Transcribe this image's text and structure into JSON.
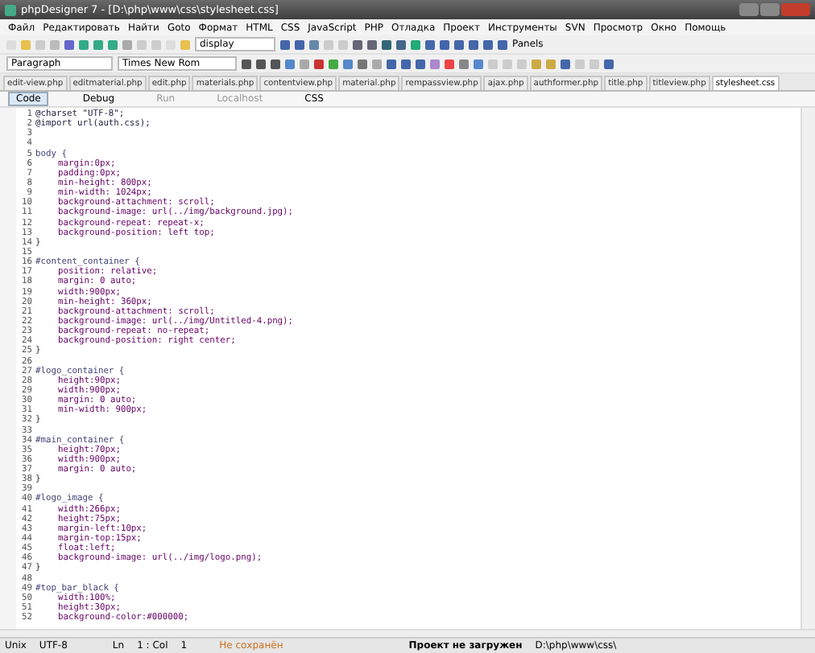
{
  "window": {
    "title": "phpDesigner 7 - [D:\\php\\www\\css\\stylesheet.css]"
  },
  "menu": [
    "Файл",
    "Редактировать",
    "Найти",
    "Goto",
    "Формат",
    "HTML",
    "CSS",
    "JavaScript",
    "PHP",
    "Отладка",
    "Проект",
    "Инструменты",
    "SVN",
    "Просмотр",
    "Окно",
    "Помощь"
  ],
  "toolbar": {
    "search_value": "display",
    "panels": "Panels"
  },
  "format_bar": {
    "paragraph": "Paragraph",
    "font": "Times New Rom"
  },
  "tabs": [
    {
      "label": "edit-view.php",
      "selected": false
    },
    {
      "label": "editmaterial.php",
      "selected": false
    },
    {
      "label": "edit.php",
      "selected": false
    },
    {
      "label": "materials.php",
      "selected": false
    },
    {
      "label": "contentview.php",
      "selected": false
    },
    {
      "label": "material.php",
      "selected": false
    },
    {
      "label": "rempassview.php",
      "selected": false
    },
    {
      "label": "ajax.php",
      "selected": false
    },
    {
      "label": "authformer.php",
      "selected": false
    },
    {
      "label": "title.php",
      "selected": false
    },
    {
      "label": "titleview.php",
      "selected": false
    },
    {
      "label": "stylesheet.css",
      "selected": true
    }
  ],
  "sub_toolbar": [
    {
      "label": "Code",
      "selected": true,
      "disabled": false
    },
    {
      "label": "Debug",
      "selected": false,
      "disabled": false
    },
    {
      "label": "Run",
      "selected": false,
      "disabled": true
    },
    {
      "label": "Localhost",
      "selected": false,
      "disabled": true
    },
    {
      "label": "CSS",
      "selected": false,
      "disabled": false
    }
  ],
  "code": [
    {
      "n": "1",
      "kind": "at",
      "text": "@charset \"UTF-8\";"
    },
    {
      "n": "2",
      "kind": "at",
      "text": "@import url(auth.css);"
    },
    {
      "n": "3",
      "kind": "blank"
    },
    {
      "n": "4",
      "kind": "blank"
    },
    {
      "n": "5",
      "kind": "selector",
      "text": "body {"
    },
    {
      "n": "6",
      "kind": "property",
      "text": "margin:0px;"
    },
    {
      "n": "7",
      "kind": "property",
      "text": "padding:0px;"
    },
    {
      "n": "8",
      "kind": "property",
      "text": "min-height: 800px;"
    },
    {
      "n": "9",
      "kind": "property",
      "text": "min-width: 1024px;"
    },
    {
      "n": "10",
      "kind": "property",
      "text": "background-attachment: scroll;"
    },
    {
      "n": "11",
      "kind": "property",
      "text": "background-image: url(../img/background.jpg);"
    },
    {
      "n": "12",
      "kind": "property",
      "text": "background-repeat: repeat-x;"
    },
    {
      "n": "13",
      "kind": "property",
      "text": "background-position: left top;"
    },
    {
      "n": "14",
      "kind": "brace",
      "text": "}"
    },
    {
      "n": "15",
      "kind": "blank"
    },
    {
      "n": "16",
      "kind": "selector",
      "text": "#content_container {"
    },
    {
      "n": "17",
      "kind": "property",
      "text": "position: relative;"
    },
    {
      "n": "18",
      "kind": "property",
      "text": "margin: 0 auto;"
    },
    {
      "n": "19",
      "kind": "property",
      "text": "width:900px;"
    },
    {
      "n": "20",
      "kind": "property",
      "text": "min-height: 360px;"
    },
    {
      "n": "21",
      "kind": "property",
      "text": "background-attachment: scroll;"
    },
    {
      "n": "22",
      "kind": "property",
      "text": "background-image: url(../img/Untitled-4.png);"
    },
    {
      "n": "23",
      "kind": "property",
      "text": "background-repeat: no-repeat;"
    },
    {
      "n": "24",
      "kind": "property",
      "text": "background-position: right center;"
    },
    {
      "n": "25",
      "kind": "brace",
      "text": "}"
    },
    {
      "n": "26",
      "kind": "blank"
    },
    {
      "n": "27",
      "kind": "selector",
      "text": "#logo_container {"
    },
    {
      "n": "28",
      "kind": "property",
      "text": "height:90px;"
    },
    {
      "n": "29",
      "kind": "property",
      "text": "width:900px;"
    },
    {
      "n": "30",
      "kind": "property",
      "text": "margin: 0 auto;"
    },
    {
      "n": "31",
      "kind": "property",
      "text": "min-width: 900px;"
    },
    {
      "n": "32",
      "kind": "brace",
      "text": "}"
    },
    {
      "n": "33",
      "kind": "blank"
    },
    {
      "n": "34",
      "kind": "selector",
      "text": "#main_container {"
    },
    {
      "n": "35",
      "kind": "property",
      "text": "height:70px;"
    },
    {
      "n": "36",
      "kind": "property",
      "text": "width:900px;"
    },
    {
      "n": "37",
      "kind": "property",
      "text": "margin: 0 auto;"
    },
    {
      "n": "38",
      "kind": "brace",
      "text": "}"
    },
    {
      "n": "39",
      "kind": "blank"
    },
    {
      "n": "40",
      "kind": "selector",
      "text": "#logo_image {"
    },
    {
      "n": "41",
      "kind": "property",
      "text": "width:266px;"
    },
    {
      "n": "42",
      "kind": "property",
      "text": "height:75px;"
    },
    {
      "n": "43",
      "kind": "property",
      "text": "margin-left:10px;"
    },
    {
      "n": "44",
      "kind": "property",
      "text": "margin-top:15px;"
    },
    {
      "n": "45",
      "kind": "property",
      "text": "float:left;"
    },
    {
      "n": "46",
      "kind": "property",
      "text": "background-image: url(../img/logo.png);"
    },
    {
      "n": "47",
      "kind": "brace",
      "text": "}"
    },
    {
      "n": "48",
      "kind": "blank"
    },
    {
      "n": "49",
      "kind": "selector",
      "text": "#top_bar_black {"
    },
    {
      "n": "50",
      "kind": "property",
      "text": "width:100%;"
    },
    {
      "n": "51",
      "kind": "property",
      "text": "height:30px;"
    },
    {
      "n": "52",
      "kind": "property",
      "text": "background-color:#000000;"
    }
  ],
  "status_bar": {
    "line_endings": "Unix",
    "encoding": "UTF-8",
    "ln_label": "Ln",
    "position": "1 : Col",
    "col": "1",
    "saved_state": "Не сохранён",
    "project": "Проект не загружен",
    "path": "D:\\php\\www\\css\\"
  }
}
